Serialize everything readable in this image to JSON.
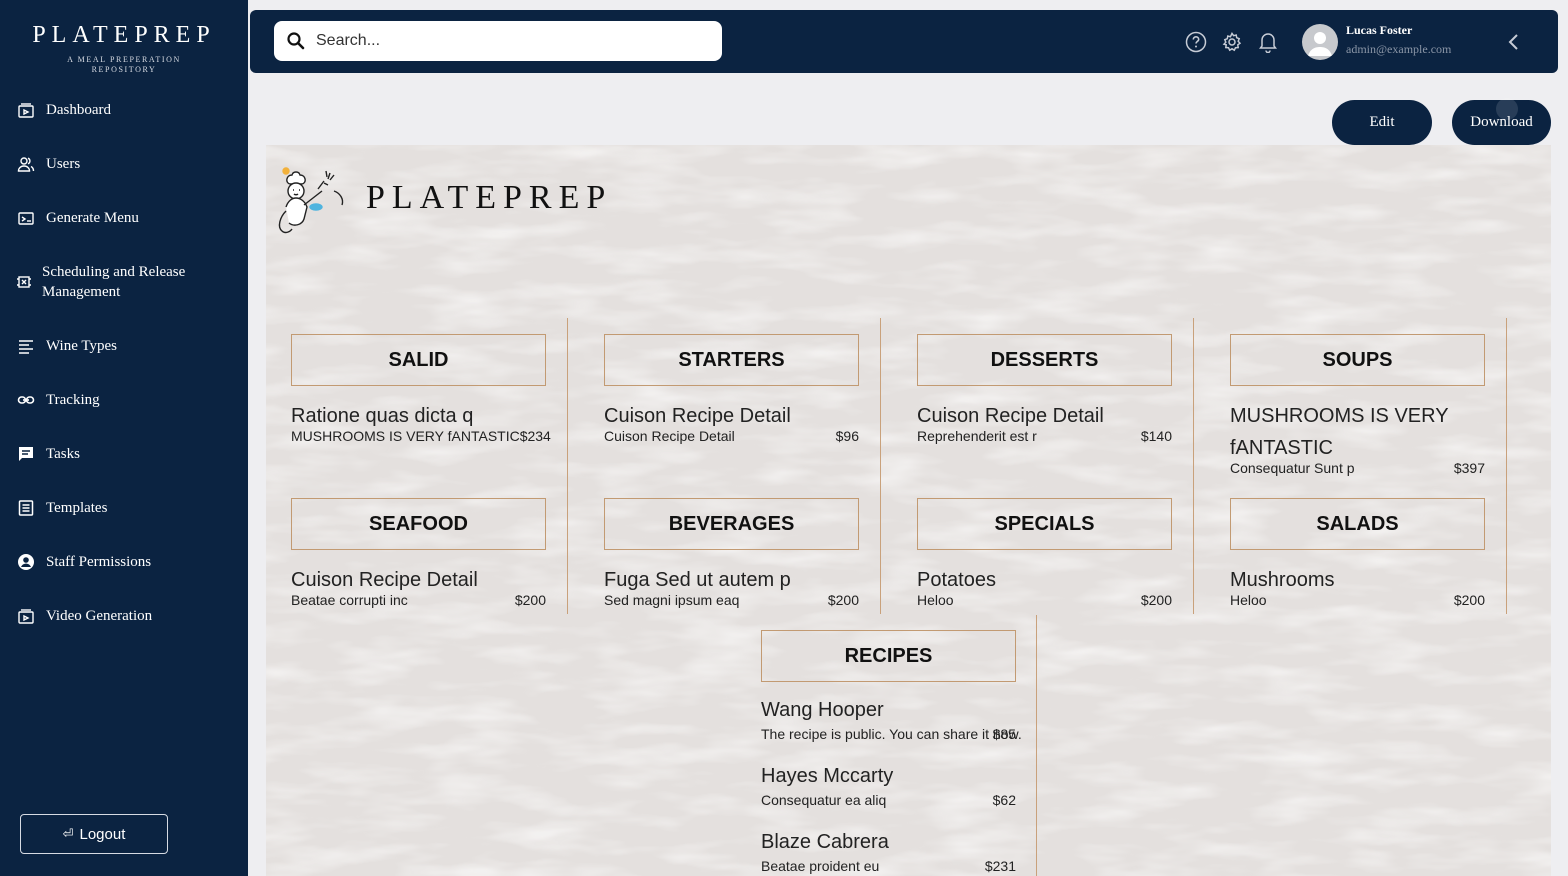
{
  "brand": {
    "title": "PLATEPREP",
    "subtitle": "A MEAL PREPERATION REPOSITORY"
  },
  "sidebar": {
    "items": [
      {
        "label": "Dashboard",
        "icon": "dashboard-icon"
      },
      {
        "label": "Users",
        "icon": "users-icon"
      },
      {
        "label": "Generate Menu",
        "icon": "generate-menu-icon"
      },
      {
        "label": "Scheduling and Release Management",
        "icon": "scheduling-icon"
      },
      {
        "label": "Wine Types",
        "icon": "list-icon"
      },
      {
        "label": "Tracking",
        "icon": "link-icon"
      },
      {
        "label": "Tasks",
        "icon": "chat-icon"
      },
      {
        "label": "Templates",
        "icon": "template-icon"
      },
      {
        "label": "Staff Permissions",
        "icon": "account-icon"
      },
      {
        "label": "Video Generation",
        "icon": "video-icon"
      }
    ],
    "logout_label": "Logout"
  },
  "topbar": {
    "search_placeholder": "Search...",
    "user_name": "Lucas Foster",
    "user_email": "admin@example.com"
  },
  "actions": {
    "edit_label": "Edit",
    "download_label": "Download"
  },
  "menu": {
    "logo_text": "PLATEPREP",
    "categories": [
      {
        "title": "SALID",
        "item": {
          "name": "Ratione quas dicta q",
          "desc": "MUSHROOMS IS VERY fANTASTIC",
          "price": "$234"
        }
      },
      {
        "title": "STARTERS",
        "item": {
          "name": "Cuison Recipe Detail",
          "desc": "Cuison Recipe Detail",
          "price": "$96"
        }
      },
      {
        "title": "DESSERTS",
        "item": {
          "name": "Cuison Recipe Detail",
          "desc": "Reprehenderit est r",
          "price": "$140"
        }
      },
      {
        "title": "SOUPS",
        "item": {
          "name": "MUSHROOMS IS VERY fANTASTIC",
          "desc": "Consequatur Sunt p",
          "price": "$397"
        }
      },
      {
        "title": "SEAFOOD",
        "item": {
          "name": "Cuison Recipe Detail",
          "desc": "Beatae corrupti inc",
          "price": "$200"
        }
      },
      {
        "title": "BEVERAGES",
        "item": {
          "name": "Fuga Sed ut autem p",
          "desc": "Sed magni ipsum eaq",
          "price": "$200"
        }
      },
      {
        "title": "SPECIALS",
        "item": {
          "name": "Potatoes",
          "desc": "Heloo",
          "price": "$200"
        }
      },
      {
        "title": "SALADS",
        "item": {
          "name": "Mushrooms",
          "desc": "Heloo",
          "price": "$200"
        }
      }
    ],
    "recipes": {
      "title": "RECIPES",
      "items": [
        {
          "name": "Wang Hooper",
          "desc": "The recipe is public. You can share it now.",
          "price": "$85"
        },
        {
          "name": "Hayes Mccarty",
          "desc": "Consequatur ea aliq",
          "price": "$62"
        },
        {
          "name": "Blaze Cabrera",
          "desc": "Beatae proident eu",
          "price": "$231"
        }
      ]
    }
  },
  "colors": {
    "navy": "#0b2341",
    "menu_bg": "#e4e0de",
    "divider": "#c9a17b"
  }
}
